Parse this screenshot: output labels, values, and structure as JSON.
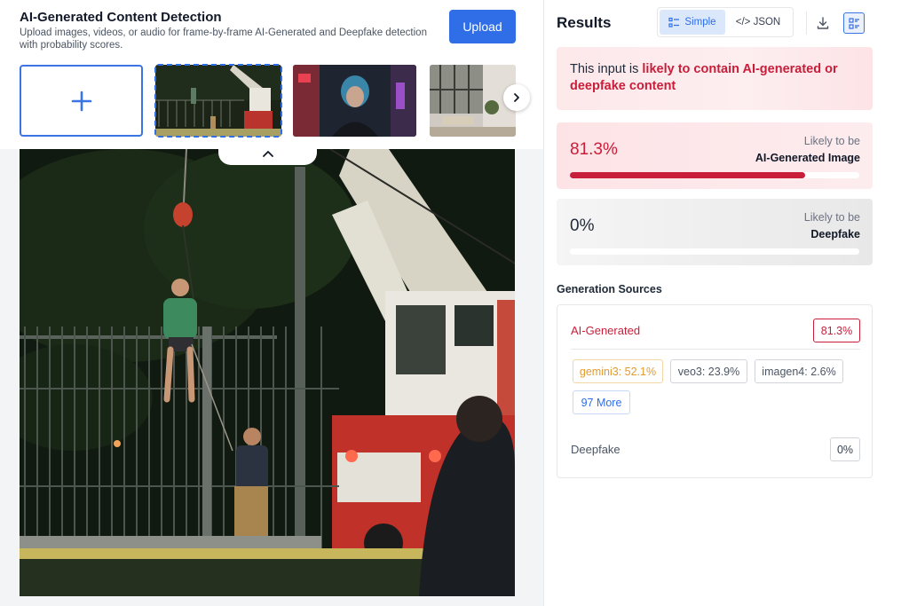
{
  "app": {
    "title": "AI-Generated Content Detection",
    "subtitle": "Upload images, videos, or audio for frame-by-frame AI-Generated and Deepfake detection with probability scores.",
    "upload_label": "Upload"
  },
  "icons": {
    "add": "plus-icon",
    "next": "chevron-right-icon",
    "collapse": "chevron-up-icon",
    "simple": "list-view-icon",
    "json": "code-icon",
    "download": "download-icon",
    "report": "report-list-icon"
  },
  "results": {
    "title": "Results",
    "view_toggle": {
      "simple": "Simple",
      "json": "</> JSON",
      "selected": "Simple"
    },
    "verdict": {
      "prefix": "This input is ",
      "highlight": "likely to contain AI-generated or deepfake content"
    },
    "scores": [
      {
        "value": "81.3%",
        "fraction": 0.813,
        "line1": "Likely to be",
        "line2": "AI-Generated Image"
      },
      {
        "value": "0%",
        "fraction": 0.0,
        "line1": "Likely to be",
        "line2": "Deepfake"
      }
    ],
    "sources": {
      "title": "Generation Sources",
      "ai_label": "AI-Generated",
      "ai_value": "81.3%",
      "models": [
        {
          "label": "gemini3: 52.1%"
        },
        {
          "label": "veo3: 23.9%"
        },
        {
          "label": "imagen4: 2.6%"
        }
      ],
      "more_label": "97 More",
      "deepfake_label": "Deepfake",
      "deepfake_value": "0%"
    }
  },
  "colors": {
    "accent": "#2f6ee6",
    "danger": "#c81e3a",
    "warning": "#e59a2c"
  }
}
